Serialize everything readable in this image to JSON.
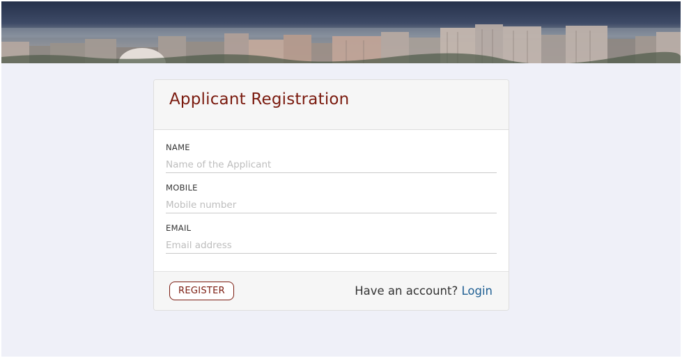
{
  "banner": {
    "image_name": "city-skyline-banner"
  },
  "form": {
    "title": "Applicant Registration",
    "fields": [
      {
        "label": "NAME",
        "placeholder": "Name of the Applicant",
        "value": ""
      },
      {
        "label": "MOBILE",
        "placeholder": "Mobile number",
        "value": ""
      },
      {
        "label": "EMAIL",
        "placeholder": "Email address",
        "value": ""
      }
    ],
    "register_label": "REGISTER",
    "account_prompt": "Have an account?",
    "login_label": "Login"
  },
  "colors": {
    "title": "#7a1a0e",
    "register_border": "#7a1a0e",
    "link": "#1f5f93",
    "page_background": "#eff0f8"
  }
}
